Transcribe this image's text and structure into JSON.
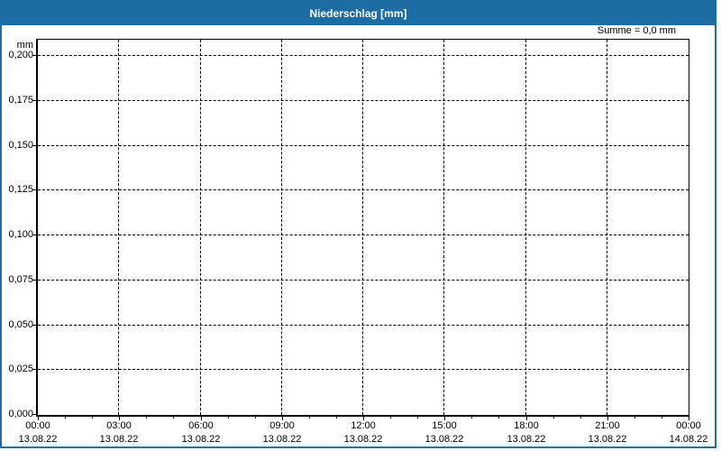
{
  "title_bar": {
    "title": "Niederschlag [mm]"
  },
  "summary_label": "Summe = 0,0 mm",
  "colors": {
    "accent_blue": "#1E6CA4",
    "grid": "#000000",
    "chart_background": "#FFFFFF",
    "title_text": "#FFFFFF",
    "axis_text": "#000000"
  },
  "chart_data": {
    "type": "bar",
    "title": "Niederschlag [mm]",
    "ylabel": "mm",
    "xlabel": "",
    "ylim": [
      0,
      0.2
    ],
    "ytick_step": 0.025,
    "ytick_labels": [
      "0,000",
      "0,025",
      "0,050",
      "0,075",
      "0,100",
      "0,125",
      "0,150",
      "0,175",
      "0,200"
    ],
    "x_major_ticks": [
      {
        "time": "00:00",
        "date": "13.08.22"
      },
      {
        "time": "03:00",
        "date": "13.08.22"
      },
      {
        "time": "06:00",
        "date": "13.08.22"
      },
      {
        "time": "09:00",
        "date": "13.08.22"
      },
      {
        "time": "12:00",
        "date": "13.08.22"
      },
      {
        "time": "15:00",
        "date": "13.08.22"
      },
      {
        "time": "18:00",
        "date": "13.08.22"
      },
      {
        "time": "21:00",
        "date": "13.08.22"
      },
      {
        "time": "00:00",
        "date": "14.08.22"
      }
    ],
    "x_minor_tick_interval_hours": 1,
    "x_major_tick_interval_hours": 3,
    "hours_span": 24,
    "grid": true,
    "legend": null,
    "series": [
      {
        "name": "Niederschlag",
        "values": [],
        "sum": 0.0
      }
    ],
    "annotations": [
      "Summe = 0,0 mm"
    ]
  }
}
